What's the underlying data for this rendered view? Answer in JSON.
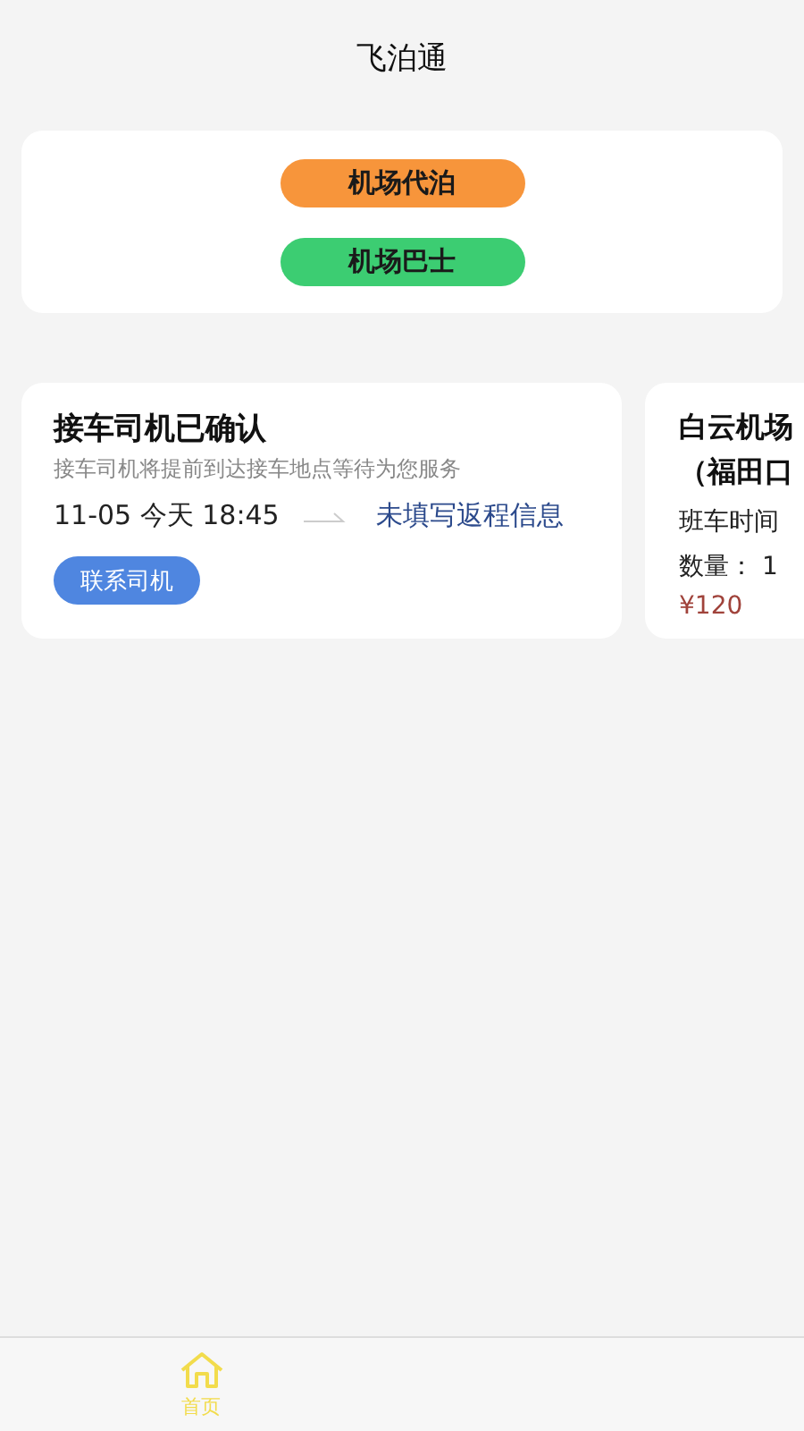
{
  "header": {
    "title": "飞泊通"
  },
  "services": [
    {
      "label": "机场代泊",
      "color": "#f7953b"
    },
    {
      "label": "机场巴士",
      "color": "#3ccd72"
    }
  ],
  "orders": [
    {
      "kind": "pickup",
      "title": "接车司机已确认",
      "subtitle": "接车司机将提前到达接车地点等待为您服务",
      "date": "11-05 今天 18:45",
      "return_info": "未填写返程信息",
      "action": "联系司机"
    },
    {
      "kind": "bus",
      "title": "白云机场",
      "subtitle": "（福田口",
      "time_label": "班车时间",
      "quantity": "数量： 1",
      "price": "¥120"
    }
  ],
  "tabs": [
    {
      "label": "首页",
      "selected": true
    }
  ]
}
